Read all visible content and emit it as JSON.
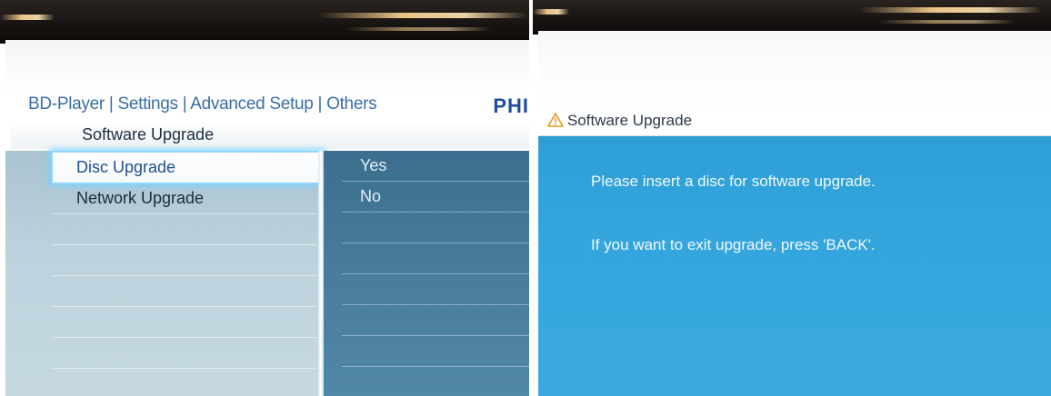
{
  "left_screen": {
    "breadcrumb": "BD-Player | Settings | Advanced Setup | Others",
    "brand": "PHI",
    "section_title": "Software Upgrade",
    "menu_items": [
      {
        "label": "Disc Upgrade",
        "selected": true
      },
      {
        "label": "Network Upgrade",
        "selected": false
      }
    ],
    "options": [
      "Yes",
      "No"
    ],
    "colors": {
      "breadcrumb": "#3b6ea5",
      "brand": "#1f4e9c",
      "selection_glow": "#8fd6ff",
      "options_panel": "#467b99"
    }
  },
  "right_screen": {
    "dialog_title": "Software Upgrade",
    "dialog_icon": "warning-icon",
    "message_1": "Please insert a disc for software upgrade.",
    "message_2": "If you want to exit upgrade, press 'BACK'.",
    "colors": {
      "dialog_body": "#34a6dd"
    }
  }
}
